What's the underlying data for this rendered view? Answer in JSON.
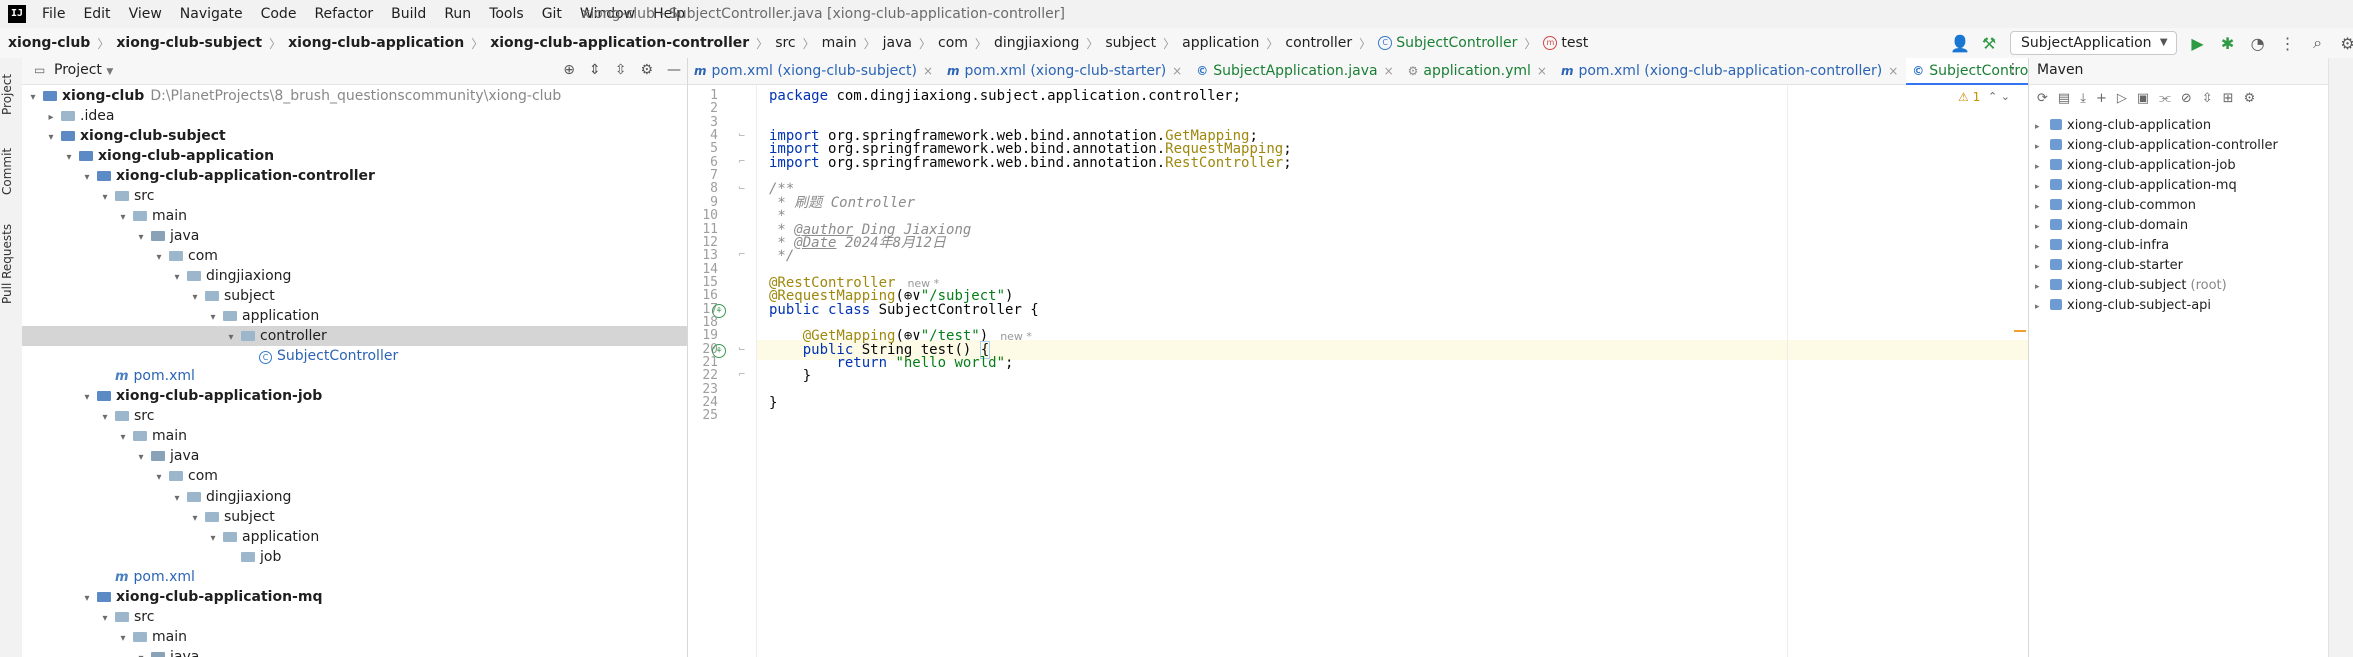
{
  "app": {
    "logo": "IJ",
    "window_title": "xiong-club - SubjectController.java [xiong-club-application-controller]",
    "menu": [
      "File",
      "Edit",
      "View",
      "Navigate",
      "Code",
      "Refactor",
      "Build",
      "Run",
      "Tools",
      "Git",
      "Window",
      "Help"
    ]
  },
  "breadcrumb": [
    "xiong-club",
    "xiong-club-subject",
    "xiong-club-application",
    "xiong-club-application-controller",
    "src",
    "main",
    "java",
    "com",
    "dingjiaxiong",
    "subject",
    "application",
    "controller",
    "SubjectController",
    "test"
  ],
  "run_config": "SubjectApplication",
  "left_stripe": [
    "Project",
    "Commit",
    "Pull Requests"
  ],
  "project": {
    "title": "Project",
    "tree": [
      {
        "label": "xiong-club",
        "path": "D:\\PlanetProjects\\8_brush_questionscommunity\\xiong-club",
        "indent": 0,
        "arrow": "▾",
        "icon": "mod",
        "bold": true
      },
      {
        "label": ".idea",
        "indent": 1,
        "arrow": "▸",
        "icon": "folder"
      },
      {
        "label": "xiong-club-subject",
        "indent": 1,
        "arrow": "▾",
        "icon": "mod",
        "bold": true
      },
      {
        "label": "xiong-club-application",
        "indent": 2,
        "arrow": "▾",
        "icon": "mod",
        "bold": true
      },
      {
        "label": "xiong-club-application-controller",
        "indent": 3,
        "arrow": "▾",
        "icon": "mod",
        "bold": true
      },
      {
        "label": "src",
        "indent": 4,
        "arrow": "▾",
        "icon": "folder"
      },
      {
        "label": "main",
        "indent": 5,
        "arrow": "▾",
        "icon": "folder"
      },
      {
        "label": "java",
        "indent": 6,
        "arrow": "▾",
        "icon": "src"
      },
      {
        "label": "com",
        "indent": 7,
        "arrow": "▾",
        "icon": "folder"
      },
      {
        "label": "dingjiaxiong",
        "indent": 8,
        "arrow": "▾",
        "icon": "folder"
      },
      {
        "label": "subject",
        "indent": 9,
        "arrow": "▾",
        "icon": "folder"
      },
      {
        "label": "application",
        "indent": 10,
        "arrow": "▾",
        "icon": "folder"
      },
      {
        "label": "controller",
        "indent": 11,
        "arrow": "▾",
        "icon": "folder",
        "selected": true
      },
      {
        "label": "SubjectController",
        "indent": 12,
        "arrow": "",
        "icon": "class",
        "blue": true
      },
      {
        "label": "pom.xml",
        "indent": 4,
        "arrow": "",
        "icon": "maven",
        "blue": true
      },
      {
        "label": "xiong-club-application-job",
        "indent": 3,
        "arrow": "▾",
        "icon": "mod",
        "bold": true
      },
      {
        "label": "src",
        "indent": 4,
        "arrow": "▾",
        "icon": "folder"
      },
      {
        "label": "main",
        "indent": 5,
        "arrow": "▾",
        "icon": "folder"
      },
      {
        "label": "java",
        "indent": 6,
        "arrow": "▾",
        "icon": "src"
      },
      {
        "label": "com",
        "indent": 7,
        "arrow": "▾",
        "icon": "folder"
      },
      {
        "label": "dingjiaxiong",
        "indent": 8,
        "arrow": "▾",
        "icon": "folder"
      },
      {
        "label": "subject",
        "indent": 9,
        "arrow": "▾",
        "icon": "folder"
      },
      {
        "label": "application",
        "indent": 10,
        "arrow": "▾",
        "icon": "folder"
      },
      {
        "label": "job",
        "indent": 11,
        "arrow": "",
        "icon": "folder"
      },
      {
        "label": "pom.xml",
        "indent": 4,
        "arrow": "",
        "icon": "maven",
        "blue": true
      },
      {
        "label": "xiong-club-application-mq",
        "indent": 3,
        "arrow": "▾",
        "icon": "mod",
        "bold": true
      },
      {
        "label": "src",
        "indent": 4,
        "arrow": "▾",
        "icon": "folder"
      },
      {
        "label": "main",
        "indent": 5,
        "arrow": "▾",
        "icon": "folder"
      },
      {
        "label": "java",
        "indent": 6,
        "arrow": "▾",
        "icon": "src"
      }
    ]
  },
  "editor": {
    "tabs": [
      {
        "label": "pom.xml (xiong-club-subject)",
        "kind": "maven"
      },
      {
        "label": "pom.xml (xiong-club-starter)",
        "kind": "maven"
      },
      {
        "label": "SubjectApplication.java",
        "kind": "java"
      },
      {
        "label": "application.yml",
        "kind": "yml"
      },
      {
        "label": "pom.xml (xiong-club-application-controller)",
        "kind": "maven"
      },
      {
        "label": "SubjectController.java",
        "kind": "java",
        "active": true
      }
    ],
    "warning_count": "1",
    "current_line": 20,
    "lines": [
      [
        {
          "t": "package ",
          "c": "kw"
        },
        {
          "t": "com.dingjiaxiong.subject.application.controller;"
        }
      ],
      [],
      [],
      [
        {
          "t": "import ",
          "c": "kw"
        },
        {
          "t": "org.springframework.web.bind.annotation."
        },
        {
          "t": "GetMapping",
          "c": "ann"
        },
        {
          "t": ";"
        }
      ],
      [
        {
          "t": "import ",
          "c": "kw"
        },
        {
          "t": "org.springframework.web.bind.annotation."
        },
        {
          "t": "RequestMapping",
          "c": "ann"
        },
        {
          "t": ";"
        }
      ],
      [
        {
          "t": "import ",
          "c": "kw"
        },
        {
          "t": "org.springframework.web.bind.annotation."
        },
        {
          "t": "RestController",
          "c": "ann"
        },
        {
          "t": ";"
        }
      ],
      [],
      [
        {
          "t": "/**",
          "c": "cmt"
        }
      ],
      [
        {
          "t": " * 刷题 Controller",
          "c": "cmt"
        }
      ],
      [
        {
          "t": " *",
          "c": "cmt"
        }
      ],
      [
        {
          "t": " * ",
          "c": "cmt"
        },
        {
          "t": "@author",
          "c": "doc-tag"
        },
        {
          "t": " Ding Jiaxiong",
          "c": "cmt"
        }
      ],
      [
        {
          "t": " * ",
          "c": "cmt"
        },
        {
          "t": "@Date",
          "c": "doc-tag"
        },
        {
          "t": " 2024年8月12日",
          "c": "cmt"
        }
      ],
      [
        {
          "t": " */",
          "c": "cmt"
        }
      ],
      [],
      [
        {
          "t": "@RestController",
          "c": "ann"
        },
        {
          "t": "new *",
          "c": "hint"
        }
      ],
      [
        {
          "t": "@RequestMapping",
          "c": "ann"
        },
        {
          "t": "(⊕∨"
        },
        {
          "t": "\"/subject\"",
          "c": "str"
        },
        {
          "t": ")"
        }
      ],
      [
        {
          "t": "public class ",
          "c": "kw"
        },
        {
          "t": "SubjectController {"
        }
      ],
      [],
      [
        {
          "t": "    "
        },
        {
          "t": "@GetMapping",
          "c": "ann"
        },
        {
          "t": "(⊕∨"
        },
        {
          "t": "\"/test\"",
          "c": "str"
        },
        {
          "t": ")"
        },
        {
          "t": "new *",
          "c": "hint"
        }
      ],
      [
        {
          "t": "    "
        },
        {
          "t": "public ",
          "c": "kw"
        },
        {
          "t": "String test() "
        },
        {
          "t": "{",
          "c": "caret"
        }
      ],
      [
        {
          "t": "        "
        },
        {
          "t": "return ",
          "c": "kw"
        },
        {
          "t": "\"hello world\"",
          "c": "str"
        },
        {
          "t": ";"
        }
      ],
      [
        {
          "t": "    }"
        }
      ],
      [],
      [
        {
          "t": "}"
        }
      ],
      []
    ]
  },
  "maven": {
    "title": "Maven",
    "items": [
      {
        "label": "xiong-club-application"
      },
      {
        "label": "xiong-club-application-controller"
      },
      {
        "label": "xiong-club-application-job"
      },
      {
        "label": "xiong-club-application-mq"
      },
      {
        "label": "xiong-club-common"
      },
      {
        "label": "xiong-club-domain"
      },
      {
        "label": "xiong-club-infra"
      },
      {
        "label": "xiong-club-starter"
      },
      {
        "label": "xiong-club-subject",
        "suffix": "(root)"
      },
      {
        "label": "xiong-club-subject-api"
      }
    ]
  }
}
